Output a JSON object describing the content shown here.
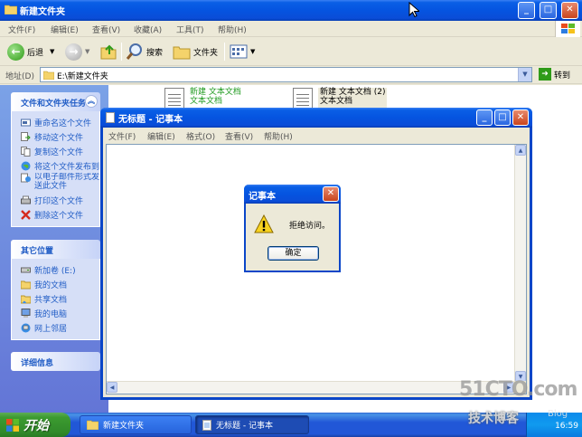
{
  "explorer": {
    "title": "新建文件夹",
    "menu": [
      "文件(F)",
      "编辑(E)",
      "查看(V)",
      "收藏(A)",
      "工具(T)",
      "帮助(H)"
    ],
    "toolbar": {
      "back": "后退",
      "search": "搜索",
      "folders": "文件夹"
    },
    "address": {
      "label": "地址(D)",
      "value": "E:\\新建文件夹",
      "go": "转到"
    },
    "task_sections": {
      "file_tasks": {
        "title": "文件和文件夹任务",
        "items": [
          {
            "label": "重命名这个文件",
            "icon": "rename-icon"
          },
          {
            "label": "移动这个文件",
            "icon": "move-icon"
          },
          {
            "label": "复制这个文件",
            "icon": "copy-icon"
          },
          {
            "label": "将这个文件发布到",
            "icon": "web-publish-icon"
          },
          {
            "label": "以电子邮件形式发送此文件",
            "icon": "email-icon"
          },
          {
            "label": "打印这个文件",
            "icon": "print-icon"
          },
          {
            "label": "删除这个文件",
            "icon": "delete-icon"
          }
        ]
      },
      "other_places": {
        "title": "其它位置",
        "items": [
          {
            "label": "新加卷 (E:)",
            "icon": "drive-icon"
          },
          {
            "label": "我的文档",
            "icon": "documents-icon"
          },
          {
            "label": "共享文档",
            "icon": "shared-docs-icon"
          },
          {
            "label": "我的电脑",
            "icon": "computer-icon"
          },
          {
            "label": "网上邻居",
            "icon": "network-icon"
          }
        ]
      },
      "details": {
        "title": "详细信息"
      }
    },
    "files": [
      {
        "name": "新建 文本文档",
        "type": "文本文档"
      },
      {
        "name": "新建 文本文档 (2)",
        "type": "文本文档"
      }
    ]
  },
  "notepad": {
    "title": "无标题 - 记事本",
    "menu": [
      "文件(F)",
      "编辑(E)",
      "格式(O)",
      "查看(V)",
      "帮助(H)"
    ]
  },
  "messagebox": {
    "title": "记事本",
    "message": "拒绝访问。",
    "ok_label": "确定"
  },
  "taskbar": {
    "start": "开始",
    "tasks": [
      {
        "label": "新建文件夹",
        "active": false
      },
      {
        "label": "无标题 - 记事本",
        "active": true
      }
    ],
    "clock": "16:59"
  },
  "watermark": {
    "main": "51CTO.com",
    "sub": "技术博客",
    "blog": "Blog"
  },
  "colors": {
    "xp_blue": "#0554e0",
    "task_link": "#215dc6",
    "start_green": "#3c9b30"
  }
}
